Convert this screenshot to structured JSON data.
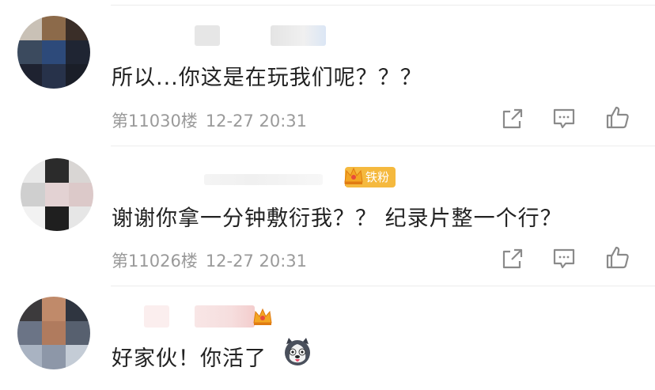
{
  "comments": [
    {
      "text": "所以...你这是在玩我们呢？？？",
      "floor": "第11030楼",
      "time": "12-27 20:31"
    },
    {
      "badge": "铁粉",
      "text": "谢谢你拿一分钟敷衍我？？ 纪录片整一个行？",
      "floor": "第11026楼",
      "time": "12-27 20:31"
    },
    {
      "text": "好家伙！你活了"
    }
  ],
  "icons": {
    "share": "share-icon",
    "comment": "comment-icon",
    "like": "thumbs-up-icon",
    "crown": "crown-badge-icon",
    "emoji": "husky-emoji"
  },
  "colors": {
    "text": "#222222",
    "meta": "#9a9a9a",
    "badge": "#f5b93e",
    "icon": "#8a8a8a"
  }
}
